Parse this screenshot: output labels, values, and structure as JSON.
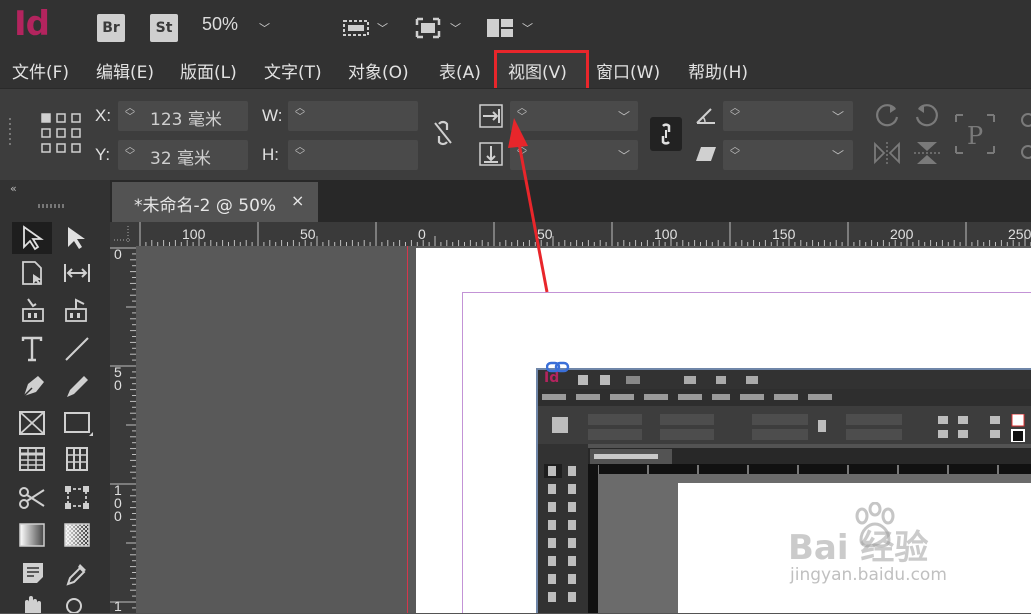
{
  "app": {
    "logo": "Id",
    "bridge_label": "Br",
    "stock_label": "St",
    "zoom_level": "50%"
  },
  "menu": {
    "items": [
      "文件(F)",
      "编辑(E)",
      "版面(L)",
      "文字(T)",
      "对象(O)",
      "表(A)",
      "视图(V)",
      "窗口(W)",
      "帮助(H)"
    ],
    "highlighted": "视图(V)",
    "highlight_color": "#e8262b"
  },
  "control": {
    "x_label": "X:",
    "x_value": "123 毫米",
    "y_label": "Y:",
    "y_value": "32 毫米",
    "w_label": "W:",
    "h_label": "H:",
    "ref_label": "P"
  },
  "tab": {
    "title": "*未命名-2 @ 50%",
    "close": "×"
  },
  "ruler": {
    "h_ticks": [
      "100",
      "50",
      "0",
      "50",
      "100",
      "150",
      "200",
      "250"
    ],
    "v_ticks": [
      "0",
      "5\n0",
      "1\n0\n0",
      "1"
    ]
  },
  "embedded": {
    "logo": "Id"
  },
  "watermark": {
    "brand": "Bai 经验",
    "url": "jingyan.baidu.com"
  },
  "colors": {
    "logo": "#b3245e",
    "bleed": "#d4374c",
    "margin": "#c393d6",
    "arrow": "#e8262b"
  }
}
